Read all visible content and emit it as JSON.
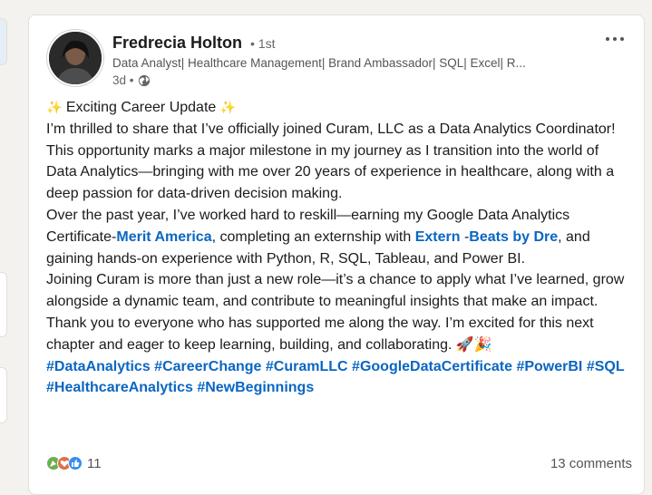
{
  "post": {
    "author": {
      "name": "Fredrecia Holton",
      "degree": "• 1st",
      "headline": "Data Analyst| Healthcare Management| Brand Ambassador| SQL| Excel| R...",
      "time": "3d •",
      "visibility_icon": "globe-icon"
    },
    "body": {
      "line1_sparkle_left": "✨",
      "line1_text": " Exciting Career Update ",
      "line1_sparkle_right": "✨",
      "p1": "I’m thrilled to share that I’ve officially joined Curam, LLC as a Data Analytics Coordinator!",
      "p2": "This opportunity marks a major milestone in my journey as I transition into the world of Data Analytics—bringing with me over 20 years of experience in healthcare, along with a deep passion for data-driven decision making.",
      "p3_a": "Over the past year, I’ve worked hard to reskill—earning my Google Data Analytics Certificate-",
      "p3_link1": "Merit America",
      "p3_b": ", completing an externship with ",
      "p3_link2": "Extern",
      "p3_c": " -",
      "p3_link3": "Beats by Dre",
      "p3_d": ", and gaining hands-on experience with Python, R, SQL, Tableau, and Power BI.",
      "p4": "Joining Curam is more than just a new role—it’s a chance to apply what I’ve learned, grow alongside a dynamic team, and contribute to meaningful insights that make an impact.",
      "p5": "Thank you to everyone who has supported me along the way. I’m excited for this next chapter and eager to keep learning, building, and collaborating. 🚀🎉",
      "hashtags": [
        "#DataAnalytics",
        "#CareerChange",
        "#CuramLLC",
        "#GoogleDataCertificate",
        "#PowerBI",
        "#SQL",
        "#HealthcareAnalytics",
        "#NewBeginnings"
      ]
    },
    "social": {
      "reaction_icons": [
        "celebrate-icon",
        "love-icon",
        "like-icon"
      ],
      "reaction_count": "11",
      "comments": "13 comments"
    }
  },
  "colors": {
    "link": "#0a66c2",
    "text": "#1b1b1b",
    "muted": "#666666",
    "background": "#f4f2ee"
  }
}
